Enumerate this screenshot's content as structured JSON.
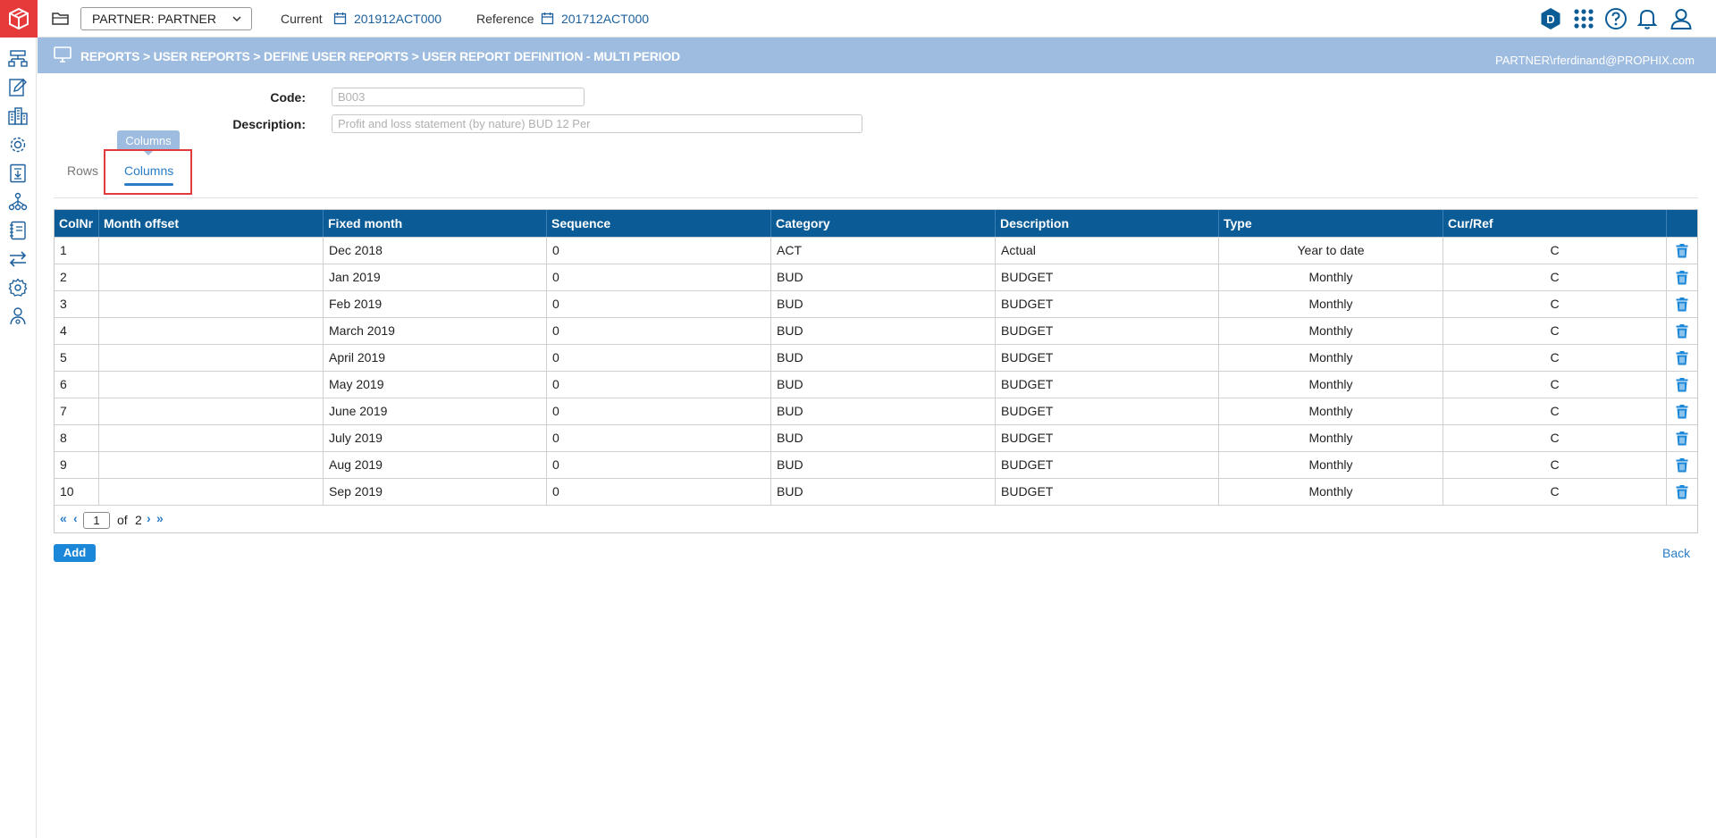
{
  "topbar": {
    "entity": "PARTNER: PARTNER",
    "current_label": "Current",
    "current_value": "201912ACT000",
    "reference_label": "Reference",
    "reference_value": "201712ACT000",
    "badge_letter": "D"
  },
  "breadcrumb": {
    "path": "REPORTS > USER REPORTS > DEFINE USER REPORTS > USER REPORT DEFINITION - MULTI PERIOD",
    "user": "PARTNER\\rferdinand@PROPHIX.com"
  },
  "form": {
    "code_label": "Code:",
    "code_value": "B003",
    "description_label": "Description:",
    "description_value": "Profit and loss statement (by nature)  BUD 12 Per"
  },
  "tabs": {
    "rows": "Rows",
    "columns": "Columns",
    "tooltip": "Columns"
  },
  "table": {
    "headers": [
      "ColNr",
      "Month offset",
      "Fixed month",
      "Sequence",
      "Category",
      "Description",
      "Type",
      "Cur/Ref"
    ],
    "rows": [
      {
        "colnr": "1",
        "offset": "",
        "fixed": "Dec 2018",
        "seq": "0",
        "cat": "ACT",
        "desc": "Actual",
        "type": "Year to date",
        "cur": "C"
      },
      {
        "colnr": "2",
        "offset": "",
        "fixed": "Jan 2019",
        "seq": "0",
        "cat": "BUD",
        "desc": "BUDGET",
        "type": "Monthly",
        "cur": "C"
      },
      {
        "colnr": "3",
        "offset": "",
        "fixed": "Feb 2019",
        "seq": "0",
        "cat": "BUD",
        "desc": "BUDGET",
        "type": "Monthly",
        "cur": "C"
      },
      {
        "colnr": "4",
        "offset": "",
        "fixed": "March 2019",
        "seq": "0",
        "cat": "BUD",
        "desc": "BUDGET",
        "type": "Monthly",
        "cur": "C"
      },
      {
        "colnr": "5",
        "offset": "",
        "fixed": "April 2019",
        "seq": "0",
        "cat": "BUD",
        "desc": "BUDGET",
        "type": "Monthly",
        "cur": "C"
      },
      {
        "colnr": "6",
        "offset": "",
        "fixed": "May 2019",
        "seq": "0",
        "cat": "BUD",
        "desc": "BUDGET",
        "type": "Monthly",
        "cur": "C"
      },
      {
        "colnr": "7",
        "offset": "",
        "fixed": "June 2019",
        "seq": "0",
        "cat": "BUD",
        "desc": "BUDGET",
        "type": "Monthly",
        "cur": "C"
      },
      {
        "colnr": "8",
        "offset": "",
        "fixed": "July 2019",
        "seq": "0",
        "cat": "BUD",
        "desc": "BUDGET",
        "type": "Monthly",
        "cur": "C"
      },
      {
        "colnr": "9",
        "offset": "",
        "fixed": "Aug 2019",
        "seq": "0",
        "cat": "BUD",
        "desc": "BUDGET",
        "type": "Monthly",
        "cur": "C"
      },
      {
        "colnr": "10",
        "offset": "",
        "fixed": "Sep 2019",
        "seq": "0",
        "cat": "BUD",
        "desc": "BUDGET",
        "type": "Monthly",
        "cur": "C"
      }
    ]
  },
  "pager": {
    "current_page": "1",
    "of_label": "of",
    "total_pages": "2",
    "first": "«",
    "prev": "‹",
    "next": "›",
    "last": "»"
  },
  "actions": {
    "add": "Add",
    "back": "Back"
  },
  "colors": {
    "logo": "#e63a3a",
    "crumb_bar": "#9dbce0",
    "table_header": "#0b5c96",
    "accent": "#2a7cc7",
    "highlight": "#e23b3b"
  }
}
